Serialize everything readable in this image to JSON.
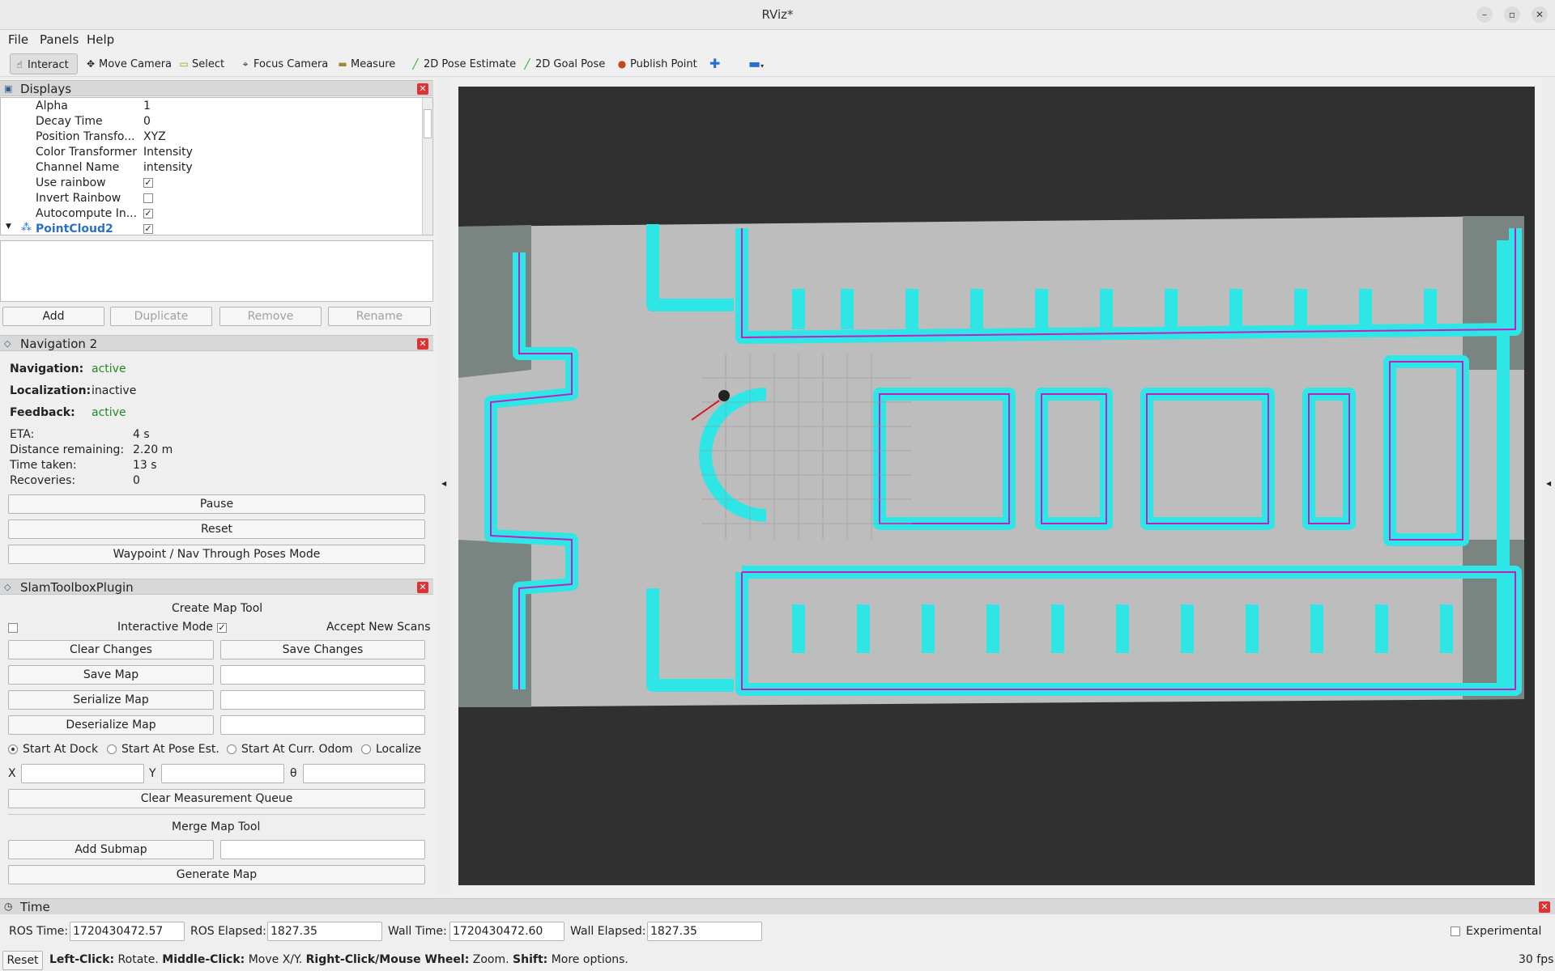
{
  "window": {
    "title": "RViz*",
    "minimize_icon": "minimize-icon",
    "maximize_icon": "maximize-icon",
    "close_icon": "close-icon"
  },
  "menu": [
    "File",
    "Panels",
    "Help"
  ],
  "toolbar": {
    "interact": "Interact",
    "move_camera": "Move Camera",
    "select": "Select",
    "focus_camera": "Focus Camera",
    "measure": "Measure",
    "pose_estimate": "2D Pose Estimate",
    "goal_pose": "2D Goal Pose",
    "publish_point": "Publish Point",
    "add_tool_icon": "plus-icon",
    "remove_tool_icon": "minus-icon"
  },
  "displays": {
    "title": "Displays",
    "rows": [
      {
        "key": "Alpha",
        "value": "1"
      },
      {
        "key": "Decay Time",
        "value": "0"
      },
      {
        "key": "Position Transfo...",
        "value": "XYZ"
      },
      {
        "key": "Color Transformer",
        "value": "Intensity"
      },
      {
        "key": "Channel Name",
        "value": "intensity"
      },
      {
        "key": "Use rainbow",
        "value": "",
        "checked": true
      },
      {
        "key": "Invert Rainbow",
        "value": "",
        "checked": false
      },
      {
        "key": "Autocompute In...",
        "value": "",
        "checked": true
      }
    ],
    "pointcloud_label": "PointCloud2",
    "buttons": {
      "add": "Add",
      "duplicate": "Duplicate",
      "remove": "Remove",
      "rename": "Rename"
    }
  },
  "nav2": {
    "title": "Navigation 2",
    "navigation_label": "Navigation:",
    "navigation_value": "active",
    "localization_label": "Localization:",
    "localization_value": "inactive",
    "feedback_label": "Feedback:",
    "feedback_value": "active",
    "eta_label": "ETA:",
    "eta_value": "4 s",
    "distance_label": "Distance remaining:",
    "distance_value": "2.20 m",
    "time_label": "Time taken:",
    "time_value": "13 s",
    "recoveries_label": "Recoveries:",
    "recoveries_value": "0",
    "pause": "Pause",
    "reset": "Reset",
    "waypoint": "Waypoint / Nav Through Poses Mode"
  },
  "slam": {
    "title": "SlamToolboxPlugin",
    "create_map_tool": "Create Map Tool",
    "interactive_mode": "Interactive Mode",
    "accept_new_scans": "Accept New Scans",
    "clear_changes": "Clear Changes",
    "save_changes": "Save Changes",
    "save_map": "Save Map",
    "serialize_map": "Serialize Map",
    "deserialize_map": "Deserialize Map",
    "start_at_dock": "Start At Dock",
    "start_at_pose_est": "Start At Pose Est.",
    "start_at_curr_odom": "Start At Curr. Odom",
    "localize": "Localize",
    "x_label": "X",
    "y_label": "Y",
    "theta_label": "θ",
    "clear_measurement_queue": "Clear Measurement Queue",
    "merge_map_tool": "Merge Map Tool",
    "add_submap": "Add Submap",
    "generate_map": "Generate Map"
  },
  "time": {
    "title": "Time",
    "ros_time_label": "ROS Time:",
    "ros_time": "1720430472.57",
    "ros_elapsed_label": "ROS Elapsed:",
    "ros_elapsed": "1827.35",
    "wall_time_label": "Wall Time:",
    "wall_time": "1720430472.60",
    "wall_elapsed_label": "Wall Elapsed:",
    "wall_elapsed": "1827.35",
    "experimental": "Experimental"
  },
  "status": {
    "reset": "Reset",
    "left_click": "Left-Click:",
    "left_click_desc": " Rotate. ",
    "middle_click": "Middle-Click:",
    "middle_click_desc": " Move X/Y. ",
    "right_click": "Right-Click/Mouse Wheel:",
    "right_click_desc": " Zoom. ",
    "shift": "Shift:",
    "shift_desc": " More options.",
    "fps": "30 fps"
  },
  "colors": {
    "costmap": "#2ee6e6",
    "obstacle": "#c020c0",
    "map_free": "#bdbdbd",
    "map_unknown": "#7a8480",
    "background": "#303030",
    "active": "#218a21"
  }
}
